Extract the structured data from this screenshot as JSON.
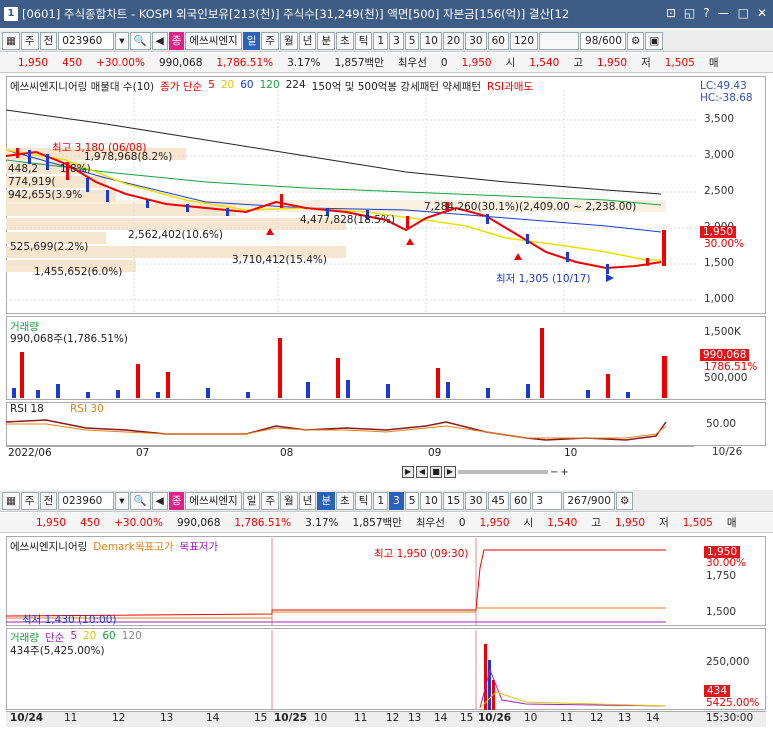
{
  "window": {
    "id_label": "1",
    "title": "[0601] 주식종합차트 - KOSPI 외국인보유[213(천)] 주식수[31,249(천)] 액면[500] 자본금[156(억)] 결산[12"
  },
  "top_toolbar": {
    "code": "023960",
    "name": "에쓰씨엔지",
    "mode_label": "주",
    "jeon": "전",
    "periods": [
      "일",
      "주",
      "월",
      "년",
      "분",
      "초",
      "틱"
    ],
    "minutes": [
      "1",
      "3",
      "5",
      "10",
      "20",
      "30",
      "60",
      "120"
    ],
    "count": "98/600"
  },
  "top_quote": {
    "price": "1,950",
    "change": "450",
    "rate": "+30.00%",
    "volume": "990,068",
    "vol_rate": "1,786.51%",
    "turnover": "3.17%",
    "amount": "1,857백만",
    "priority_label": "최우선",
    "priority_value": "0",
    "ask": "1,950",
    "open_label": "시",
    "open": "1,540",
    "high_label": "고",
    "high": "1,950",
    "low_label": "저",
    "low": "1,505",
    "extra": "매"
  },
  "top_legend": {
    "name": "에쓰씨엔지니어링 매물대 수(10)",
    "close_label": "종가 단순",
    "ma": [
      "5",
      "20",
      "60",
      "120",
      "224"
    ],
    "extra": "150억 및 500억봉 강세패턴  약세패턴",
    "rsi": "RSI과매도",
    "lc": "LC:49.43",
    "hc": "HC:-38.68"
  },
  "top_price_axis": [
    "3,500",
    "3,000",
    "2,500",
    "2,000",
    "1,500",
    "1,000"
  ],
  "top_price_box": {
    "price": "1,950",
    "rate": "30.00%"
  },
  "annotations": {
    "high": "최고 3,180 (06/08)",
    "v1": "1,978,968(8.2%)",
    "v2": "448,2",
    "v2b": "1.8%)",
    "v3": "774,919(",
    "v4": "942,655(3.9%",
    "v5": "2,562,402(10.6%)",
    "v6": "525,699(2.2%)",
    "v7": "4,477,828(18.5%)",
    "v8": "3,710,412(15.4%)",
    "v9": "1,455,652(6.0%)",
    "v10": "7,284,260(30.1%)(2,409.00 ~ 2,238.00)",
    "low": "최저 1,305 (10/17)"
  },
  "volume_pane": {
    "label": "거래량",
    "value": "990,068주(1,786.51%)",
    "axis": [
      "1,500K",
      "500,000"
    ],
    "box": "990,068",
    "box_rate": "1786.51%"
  },
  "rsi_pane": {
    "label": "RSI 18",
    "label2": "RSI 30",
    "axis": "50.00"
  },
  "top_dates": [
    "2022/06",
    "07",
    "08",
    "09",
    "10",
    "10/26"
  ],
  "bottom_toolbar": {
    "code": "023960",
    "name": "에쓰씨엔지",
    "mode_label": "주",
    "jeon": "전",
    "periods": [
      "일",
      "주",
      "월",
      "년",
      "분",
      "초",
      "틱"
    ],
    "minutes": [
      "1",
      "3",
      "5",
      "10",
      "15",
      "30",
      "45",
      "60"
    ],
    "sel_min": "3",
    "count": "267/900"
  },
  "bottom_quote": {
    "price": "1,950",
    "change": "450",
    "rate": "+30.00%",
    "volume": "990,068",
    "vol_rate": "1,786.51%",
    "turnover": "3.17%",
    "amount": "1,857백만",
    "priority_label": "최우선",
    "priority_value": "0",
    "ask": "1,950",
    "open_label": "시",
    "open": "1,540",
    "high_label": "고",
    "high": "1,950",
    "low_label": "저",
    "low": "1,505",
    "extra": "매"
  },
  "bottom_legend": {
    "name": "에쓰씨엔지니어링",
    "demark": "Demark목표고가",
    "target_low": "목표저가"
  },
  "bottom_annotations": {
    "high": "최고 1,950 (09:30)",
    "low": "최저 1,430 (10:00)"
  },
  "bottom_price_axis": [
    "1,750",
    "1,500"
  ],
  "bottom_price_box": {
    "price": "1,950",
    "rate": "30.00%"
  },
  "bottom_volume": {
    "label": "거래량",
    "ma_label": "단순",
    "ma": [
      "5",
      "20",
      "60",
      "120"
    ],
    "value": "434주(5,425.00%)",
    "axis": "250,000",
    "box": "434",
    "box_rate": "5425.00%"
  },
  "bottom_dates": [
    "10/24",
    "11",
    "12",
    "13",
    "14",
    "15",
    "10/25",
    "10",
    "11",
    "12",
    "13",
    "14",
    "15",
    "10/26",
    "10",
    "11",
    "12",
    "13",
    "14",
    "15:30:00"
  ]
}
